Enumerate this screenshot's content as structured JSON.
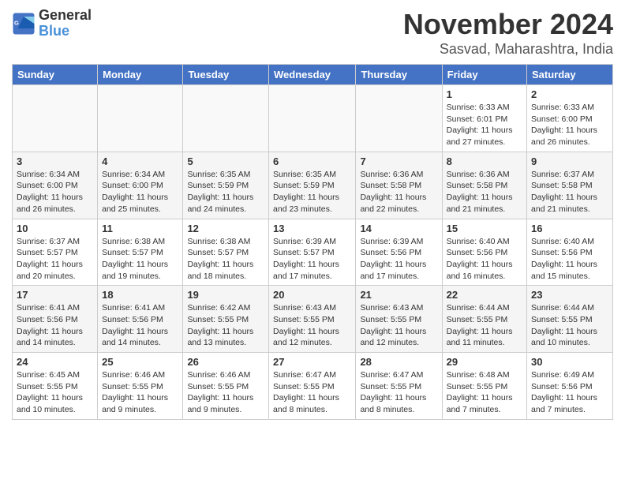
{
  "header": {
    "logo_line1": "General",
    "logo_line2": "Blue",
    "month_title": "November 2024",
    "location": "Sasvad, Maharashtra, India"
  },
  "weekdays": [
    "Sunday",
    "Monday",
    "Tuesday",
    "Wednesday",
    "Thursday",
    "Friday",
    "Saturday"
  ],
  "weeks": [
    [
      {
        "day": "",
        "info": ""
      },
      {
        "day": "",
        "info": ""
      },
      {
        "day": "",
        "info": ""
      },
      {
        "day": "",
        "info": ""
      },
      {
        "day": "",
        "info": ""
      },
      {
        "day": "1",
        "info": "Sunrise: 6:33 AM\nSunset: 6:01 PM\nDaylight: 11 hours\nand 27 minutes."
      },
      {
        "day": "2",
        "info": "Sunrise: 6:33 AM\nSunset: 6:00 PM\nDaylight: 11 hours\nand 26 minutes."
      }
    ],
    [
      {
        "day": "3",
        "info": "Sunrise: 6:34 AM\nSunset: 6:00 PM\nDaylight: 11 hours\nand 26 minutes."
      },
      {
        "day": "4",
        "info": "Sunrise: 6:34 AM\nSunset: 6:00 PM\nDaylight: 11 hours\nand 25 minutes."
      },
      {
        "day": "5",
        "info": "Sunrise: 6:35 AM\nSunset: 5:59 PM\nDaylight: 11 hours\nand 24 minutes."
      },
      {
        "day": "6",
        "info": "Sunrise: 6:35 AM\nSunset: 5:59 PM\nDaylight: 11 hours\nand 23 minutes."
      },
      {
        "day": "7",
        "info": "Sunrise: 6:36 AM\nSunset: 5:58 PM\nDaylight: 11 hours\nand 22 minutes."
      },
      {
        "day": "8",
        "info": "Sunrise: 6:36 AM\nSunset: 5:58 PM\nDaylight: 11 hours\nand 21 minutes."
      },
      {
        "day": "9",
        "info": "Sunrise: 6:37 AM\nSunset: 5:58 PM\nDaylight: 11 hours\nand 21 minutes."
      }
    ],
    [
      {
        "day": "10",
        "info": "Sunrise: 6:37 AM\nSunset: 5:57 PM\nDaylight: 11 hours\nand 20 minutes."
      },
      {
        "day": "11",
        "info": "Sunrise: 6:38 AM\nSunset: 5:57 PM\nDaylight: 11 hours\nand 19 minutes."
      },
      {
        "day": "12",
        "info": "Sunrise: 6:38 AM\nSunset: 5:57 PM\nDaylight: 11 hours\nand 18 minutes."
      },
      {
        "day": "13",
        "info": "Sunrise: 6:39 AM\nSunset: 5:57 PM\nDaylight: 11 hours\nand 17 minutes."
      },
      {
        "day": "14",
        "info": "Sunrise: 6:39 AM\nSunset: 5:56 PM\nDaylight: 11 hours\nand 17 minutes."
      },
      {
        "day": "15",
        "info": "Sunrise: 6:40 AM\nSunset: 5:56 PM\nDaylight: 11 hours\nand 16 minutes."
      },
      {
        "day": "16",
        "info": "Sunrise: 6:40 AM\nSunset: 5:56 PM\nDaylight: 11 hours\nand 15 minutes."
      }
    ],
    [
      {
        "day": "17",
        "info": "Sunrise: 6:41 AM\nSunset: 5:56 PM\nDaylight: 11 hours\nand 14 minutes."
      },
      {
        "day": "18",
        "info": "Sunrise: 6:41 AM\nSunset: 5:56 PM\nDaylight: 11 hours\nand 14 minutes."
      },
      {
        "day": "19",
        "info": "Sunrise: 6:42 AM\nSunset: 5:55 PM\nDaylight: 11 hours\nand 13 minutes."
      },
      {
        "day": "20",
        "info": "Sunrise: 6:43 AM\nSunset: 5:55 PM\nDaylight: 11 hours\nand 12 minutes."
      },
      {
        "day": "21",
        "info": "Sunrise: 6:43 AM\nSunset: 5:55 PM\nDaylight: 11 hours\nand 12 minutes."
      },
      {
        "day": "22",
        "info": "Sunrise: 6:44 AM\nSunset: 5:55 PM\nDaylight: 11 hours\nand 11 minutes."
      },
      {
        "day": "23",
        "info": "Sunrise: 6:44 AM\nSunset: 5:55 PM\nDaylight: 11 hours\nand 10 minutes."
      }
    ],
    [
      {
        "day": "24",
        "info": "Sunrise: 6:45 AM\nSunset: 5:55 PM\nDaylight: 11 hours\nand 10 minutes."
      },
      {
        "day": "25",
        "info": "Sunrise: 6:46 AM\nSunset: 5:55 PM\nDaylight: 11 hours\nand 9 minutes."
      },
      {
        "day": "26",
        "info": "Sunrise: 6:46 AM\nSunset: 5:55 PM\nDaylight: 11 hours\nand 9 minutes."
      },
      {
        "day": "27",
        "info": "Sunrise: 6:47 AM\nSunset: 5:55 PM\nDaylight: 11 hours\nand 8 minutes."
      },
      {
        "day": "28",
        "info": "Sunrise: 6:47 AM\nSunset: 5:55 PM\nDaylight: 11 hours\nand 8 minutes."
      },
      {
        "day": "29",
        "info": "Sunrise: 6:48 AM\nSunset: 5:55 PM\nDaylight: 11 hours\nand 7 minutes."
      },
      {
        "day": "30",
        "info": "Sunrise: 6:49 AM\nSunset: 5:56 PM\nDaylight: 11 hours\nand 7 minutes."
      }
    ]
  ]
}
